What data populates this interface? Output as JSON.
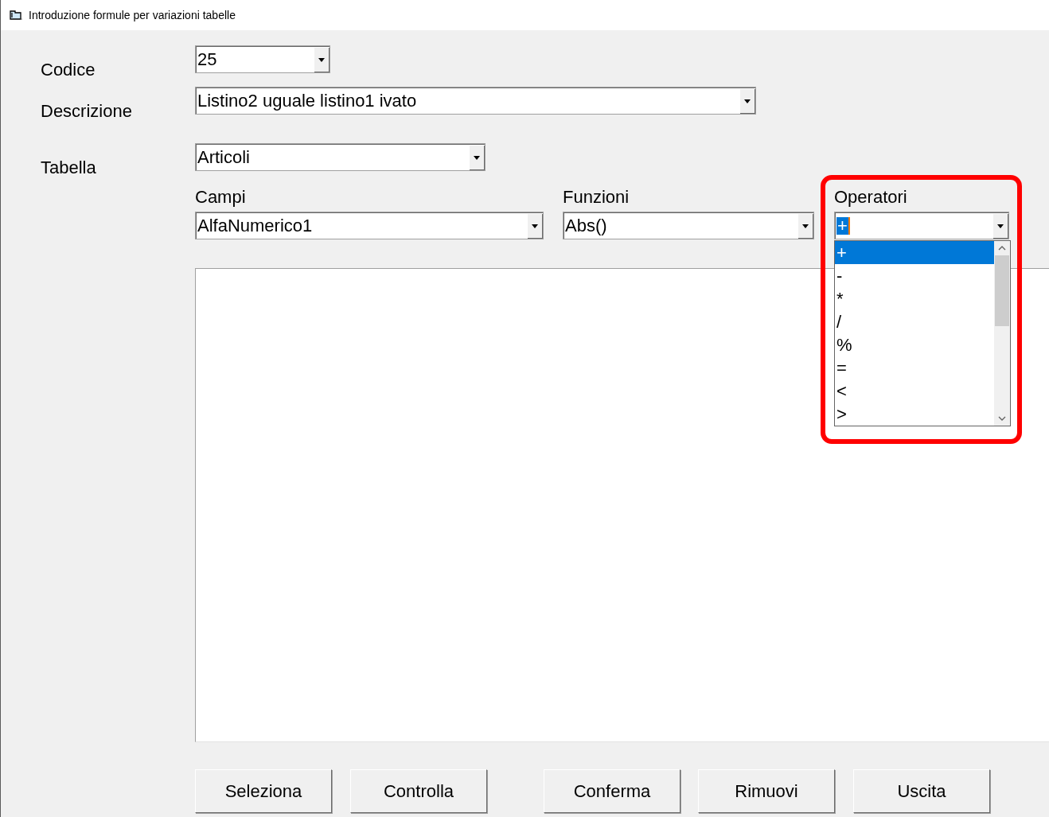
{
  "window": {
    "title": "Introduzione formule per variazioni tabelle"
  },
  "fields": [
    {
      "label": "Codice",
      "value": "25"
    },
    {
      "label": "Descrizione",
      "value": "Listino2 uguale listino1 ivato"
    },
    {
      "label": "Tabella",
      "value": "Articoli"
    }
  ],
  "pickers": [
    {
      "label": "Campi",
      "value": "AlfaNumerico1",
      "highlighted": false,
      "expanded": false
    },
    {
      "label": "Funzioni",
      "value": "Abs()",
      "highlighted": false,
      "expanded": false
    },
    {
      "label": "Operatori",
      "value": "+",
      "highlighted": true,
      "expanded": true,
      "options": [
        {
          "label": "+",
          "selected": true
        },
        {
          "label": "-",
          "selected": false
        },
        {
          "label": "*",
          "selected": false
        },
        {
          "label": "/",
          "selected": false
        },
        {
          "label": "%",
          "selected": false
        },
        {
          "label": "=",
          "selected": false
        },
        {
          "label": "<",
          "selected": false
        },
        {
          "label": ">",
          "selected": false
        }
      ]
    }
  ],
  "buttons": [
    {
      "label": "Seleziona"
    },
    {
      "label": "Controlla"
    },
    {
      "label": "Conferma"
    },
    {
      "label": "Rimuovi"
    },
    {
      "label": "Uscita"
    }
  ]
}
